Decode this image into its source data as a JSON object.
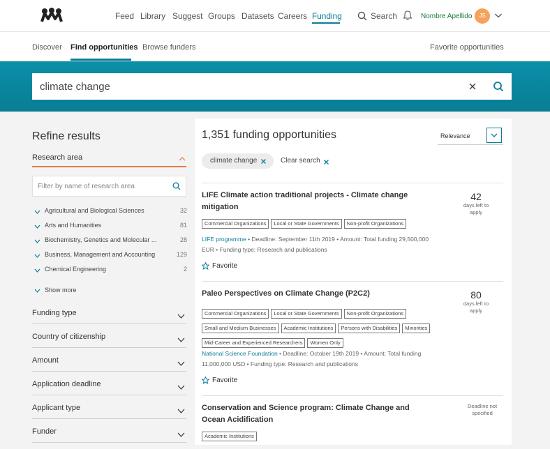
{
  "topnav": {
    "links": [
      "Feed",
      "Library",
      "Suggest",
      "Groups",
      "Datasets",
      "Careers",
      "Funding"
    ],
    "search_label": "Search",
    "username": "Nombre Apellido",
    "avatar_initials": "JS"
  },
  "subnav": {
    "discover": "Discover",
    "find": "Find opportunities",
    "browse": "Browse funders",
    "favorite": "Favorite opportunities"
  },
  "search": {
    "query": "climate change"
  },
  "sidebar": {
    "title": "Refine results",
    "research_area": "Research area",
    "filter_placeholder": "Filter by name of research area",
    "categories": [
      {
        "label": "Agricultural and Biological Sciences",
        "count": "32"
      },
      {
        "label": "Arts and Humanities",
        "count": "81"
      },
      {
        "label": "Biochemistry, Genetics and Molecular ...",
        "count": "28"
      },
      {
        "label": "Business, Management and Accounting",
        "count": "129"
      },
      {
        "label": "Chemical Engineering",
        "count": "2"
      }
    ],
    "show_more": "Show more",
    "facets": [
      "Funding type",
      "Country of citizenship",
      "Amount",
      "Application deadline",
      "Applicant type",
      "Funder"
    ]
  },
  "results": {
    "count_title": "1,351 funding opportunities",
    "sort": "Relevance",
    "chip": "climate change",
    "clear_search": "Clear search",
    "items": [
      {
        "title": "LIFE Climate action traditional projects - Climate change mitigation",
        "days": "42",
        "days_text": "days left to apply",
        "tags": [
          "Commercial Organizations",
          "Local or State Governments",
          "Non-profit Organizations"
        ],
        "funder": "LIFE programme",
        "meta_rest": " • Deadline:  September 11th 2019 • Amount: Total funding 29,500,000 EUR • Funding type: Research and publications",
        "favorite": "Favorite"
      },
      {
        "title": "Paleo Perspectives on Climate Change (P2C2)",
        "days": "80",
        "days_text": "days left to apply",
        "tags": [
          "Commercial Organizations",
          "Local or State Governments",
          "Non-profit Organizations",
          "Small and Medium Businesses",
          "Academic Institutions",
          "Persons with Disabilities",
          "Minorities",
          "Mid-Career and Experienced Researchers",
          "Women Only"
        ],
        "funder": "National Science Foundation",
        "meta_rest": " • Deadline:  October 19th 2019 • Amount: Total funding 11,000,000 USD • Funding type: Research and publications",
        "favorite": "Favorite"
      },
      {
        "title": "Conservation and Science program: Climate Change and Ocean Acidification",
        "deadline_note": "Deadline not specified",
        "tags": [
          "Academic Institutions"
        ]
      }
    ]
  }
}
